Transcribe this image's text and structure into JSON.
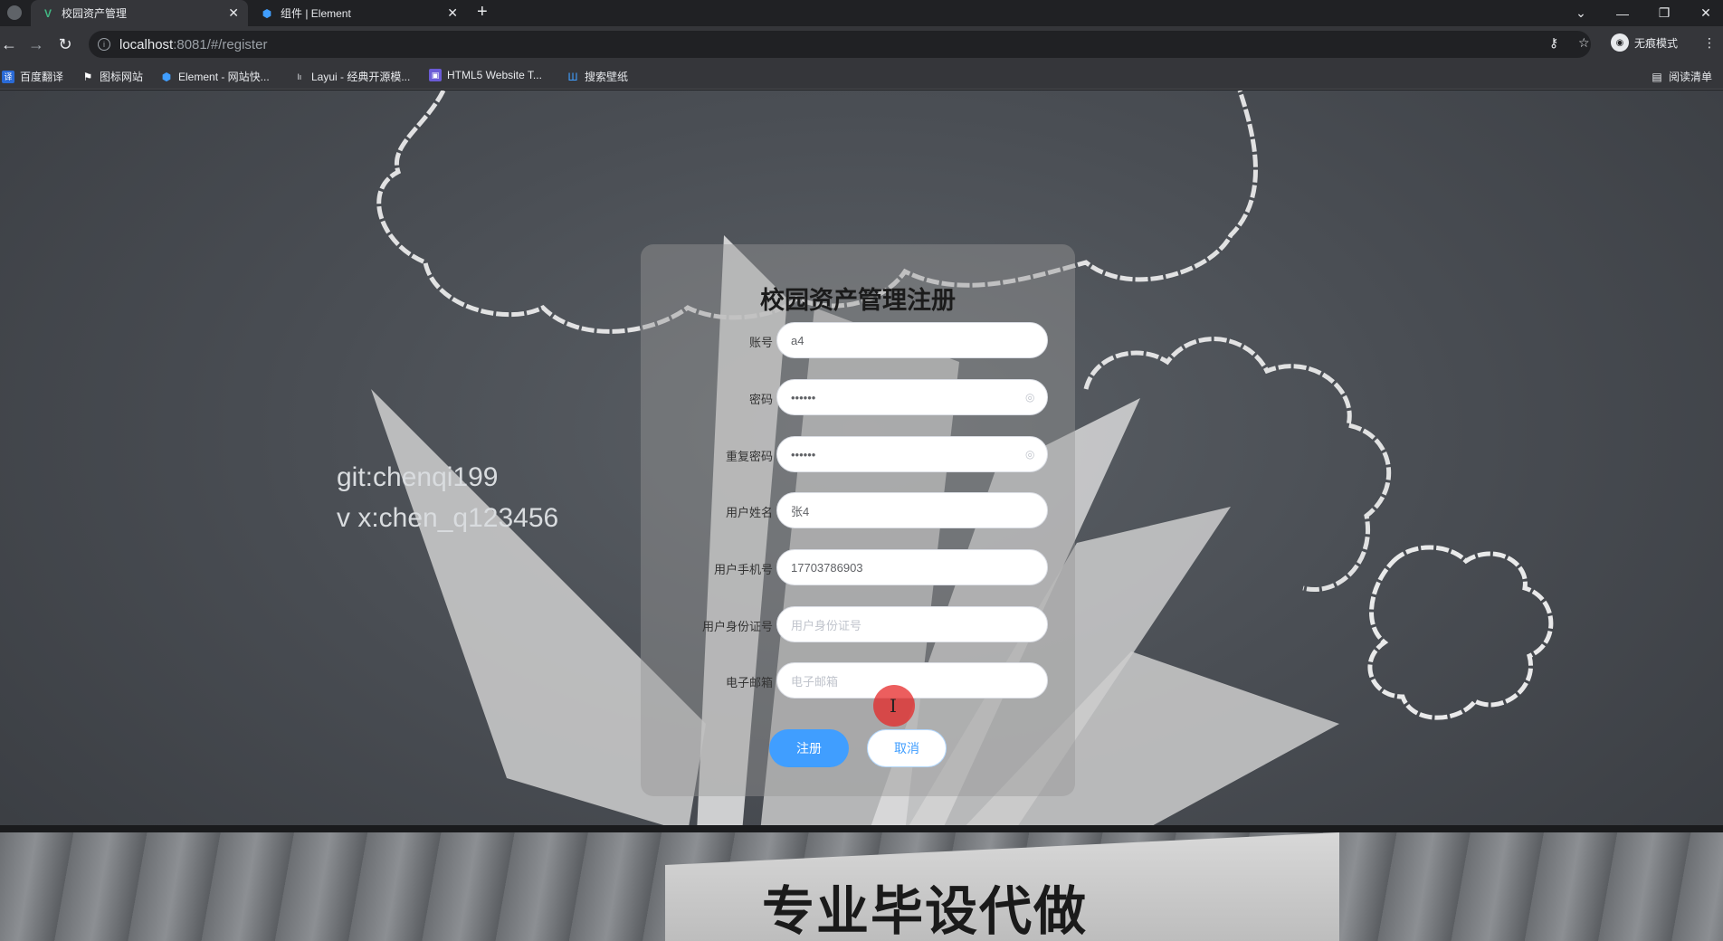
{
  "browser": {
    "tabs": [
      {
        "title": "校园资产管理",
        "active": true
      },
      {
        "title": "组件 | Element",
        "active": false
      }
    ],
    "address": {
      "host": "localhost",
      "path": ":8081/#/register"
    },
    "profile_label": "无痕模式",
    "bookmarks": [
      "百度翻译",
      "图标网站",
      "Element - 网站快...",
      "Layui - 经典开源模...",
      "HTML5 Website T...",
      "搜索壁纸"
    ],
    "reading_list": "阅读清单"
  },
  "page": {
    "watermark_line1": "git:chenqi199",
    "watermark_line2": "v x:chen_q123456",
    "banner": "专业毕设代做"
  },
  "form": {
    "title": "校园资产管理注册",
    "fields": [
      {
        "label": "账号",
        "value": "a4",
        "placeholder": ""
      },
      {
        "label": "密码",
        "value": "••••••",
        "placeholder": ""
      },
      {
        "label": "重复密码",
        "value": "••••••",
        "placeholder": ""
      },
      {
        "label": "用户姓名",
        "value": "张4",
        "placeholder": ""
      },
      {
        "label": "用户手机号",
        "value": "17703786903",
        "placeholder": ""
      },
      {
        "label": "用户身份证号",
        "value": "",
        "placeholder": "用户身份证号"
      },
      {
        "label": "电子邮箱",
        "value": "",
        "placeholder": "电子邮箱"
      }
    ],
    "submit_label": "注册",
    "cancel_label": "取消"
  },
  "colors": {
    "primary": "#409eff",
    "chrome_dark": "#202124",
    "chrome_mid": "#35363a"
  },
  "icons": [
    "vue-logo-icon",
    "element-logo-icon",
    "back-icon",
    "forward-icon",
    "reload-icon",
    "info-icon",
    "key-icon",
    "star-icon",
    "eye-icon",
    "menu-icon"
  ]
}
